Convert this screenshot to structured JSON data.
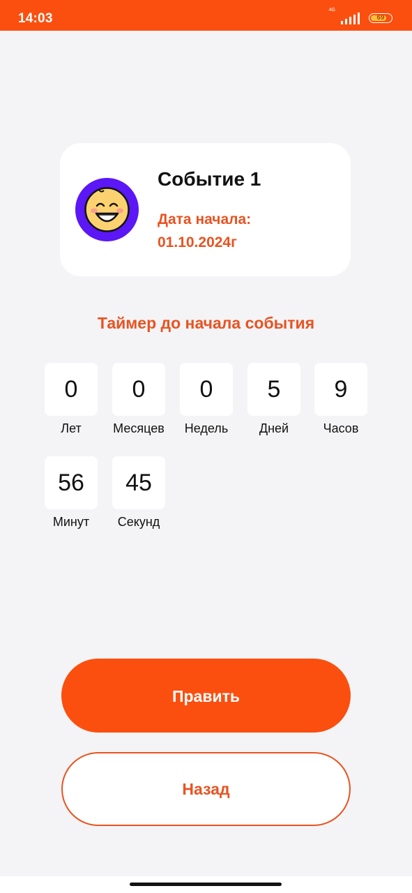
{
  "status_bar": {
    "time": "14:03",
    "network": "4G",
    "battery": "69"
  },
  "event": {
    "title": "Событие 1",
    "date_label": "Дата начала:",
    "date_value": "01.10.2024г",
    "avatar_icon": "smiley-face-icon"
  },
  "timer": {
    "title": "Таймер до начала события",
    "units": [
      {
        "value": "0",
        "label": "Лет"
      },
      {
        "value": "0",
        "label": "Месяцев"
      },
      {
        "value": "0",
        "label": "Недель"
      },
      {
        "value": "5",
        "label": "Дней"
      },
      {
        "value": "9",
        "label": "Часов"
      },
      {
        "value": "56",
        "label": "Минут"
      },
      {
        "value": "45",
        "label": "Секунд"
      }
    ]
  },
  "actions": {
    "edit_label": "Править",
    "back_label": "Назад"
  },
  "colors": {
    "accent": "#fb4f0f",
    "accent_text": "#e85321",
    "avatar_bg": "#5b17f5",
    "background": "#f4f4f6"
  }
}
